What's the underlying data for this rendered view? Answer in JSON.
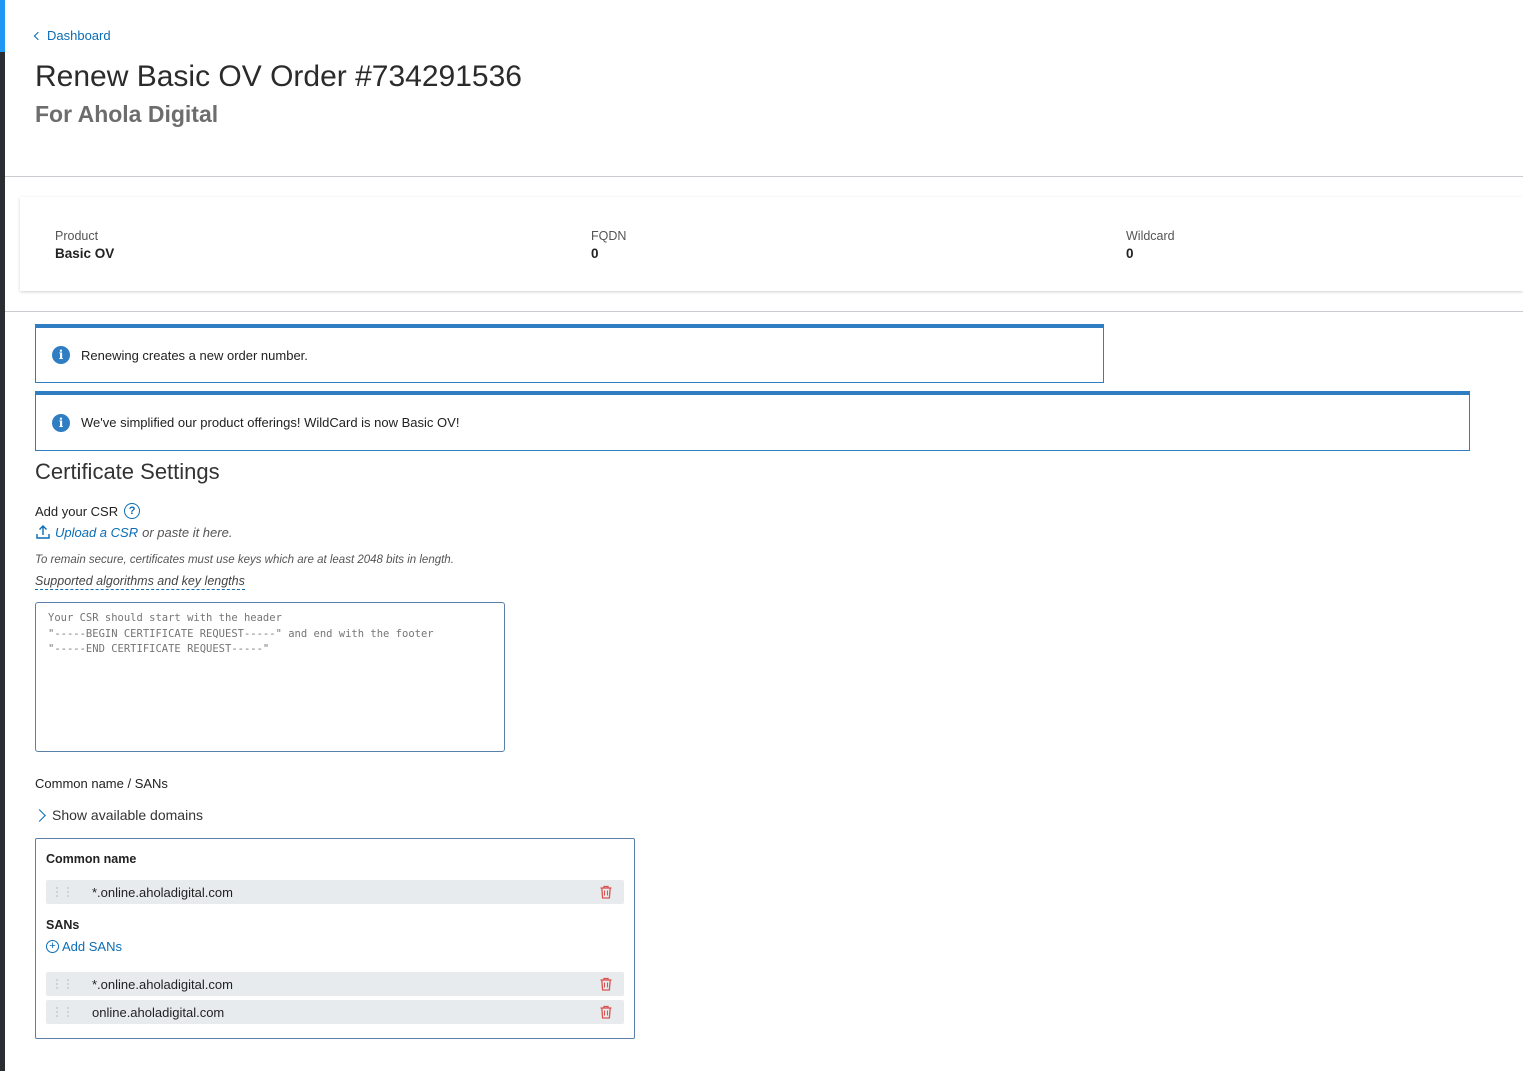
{
  "nav": {
    "back_label": "Dashboard"
  },
  "header": {
    "title": "Renew Basic OV Order #734291536",
    "subtitle": "For Ahola Digital"
  },
  "summary": {
    "product_label": "Product",
    "product_value": "Basic OV",
    "fqdn_label": "FQDN",
    "fqdn_value": "0",
    "wildcard_label": "Wildcard",
    "wildcard_value": "0"
  },
  "alerts": [
    {
      "text": "Renewing creates a new order number."
    },
    {
      "text": "We've simplified our product offerings! WildCard is now Basic OV!"
    }
  ],
  "certificate_settings": {
    "title": "Certificate Settings",
    "csr_label": "Add your CSR",
    "upload_link": "Upload a CSR",
    "upload_suffix": "or paste it here.",
    "key_note": "To remain secure, certificates must use keys which are at least 2048 bits in length.",
    "algorithms_link": "Supported algorithms and key lengths",
    "csr_placeholder": "Your CSR should start with the header\n\"-----BEGIN CERTIFICATE REQUEST-----\" and end with the footer\n\"-----END CERTIFICATE REQUEST-----\"",
    "csr_value": ""
  },
  "domains": {
    "section_label": "Common name / SANs",
    "show_available_label": "Show available domains",
    "common_name_heading": "Common name",
    "common_name": "*.online.aholadigital.com",
    "sans_heading": "SANs",
    "add_sans_label": "Add SANs",
    "sans": [
      "*.online.aholadigital.com",
      "online.aholadigital.com"
    ]
  },
  "colors": {
    "accent": "#0a6db5",
    "info_blue": "#2f7dc2",
    "delete_red": "#d9534f",
    "rail_accent": "#2196f3"
  },
  "icons": {
    "back": "chevron-left-icon",
    "info": "info-icon",
    "help": "help-circle-icon",
    "upload": "upload-icon",
    "expand": "chevron-right-icon",
    "drag": "drag-handle-icon",
    "delete": "trash-icon",
    "add": "plus-circle-icon"
  }
}
